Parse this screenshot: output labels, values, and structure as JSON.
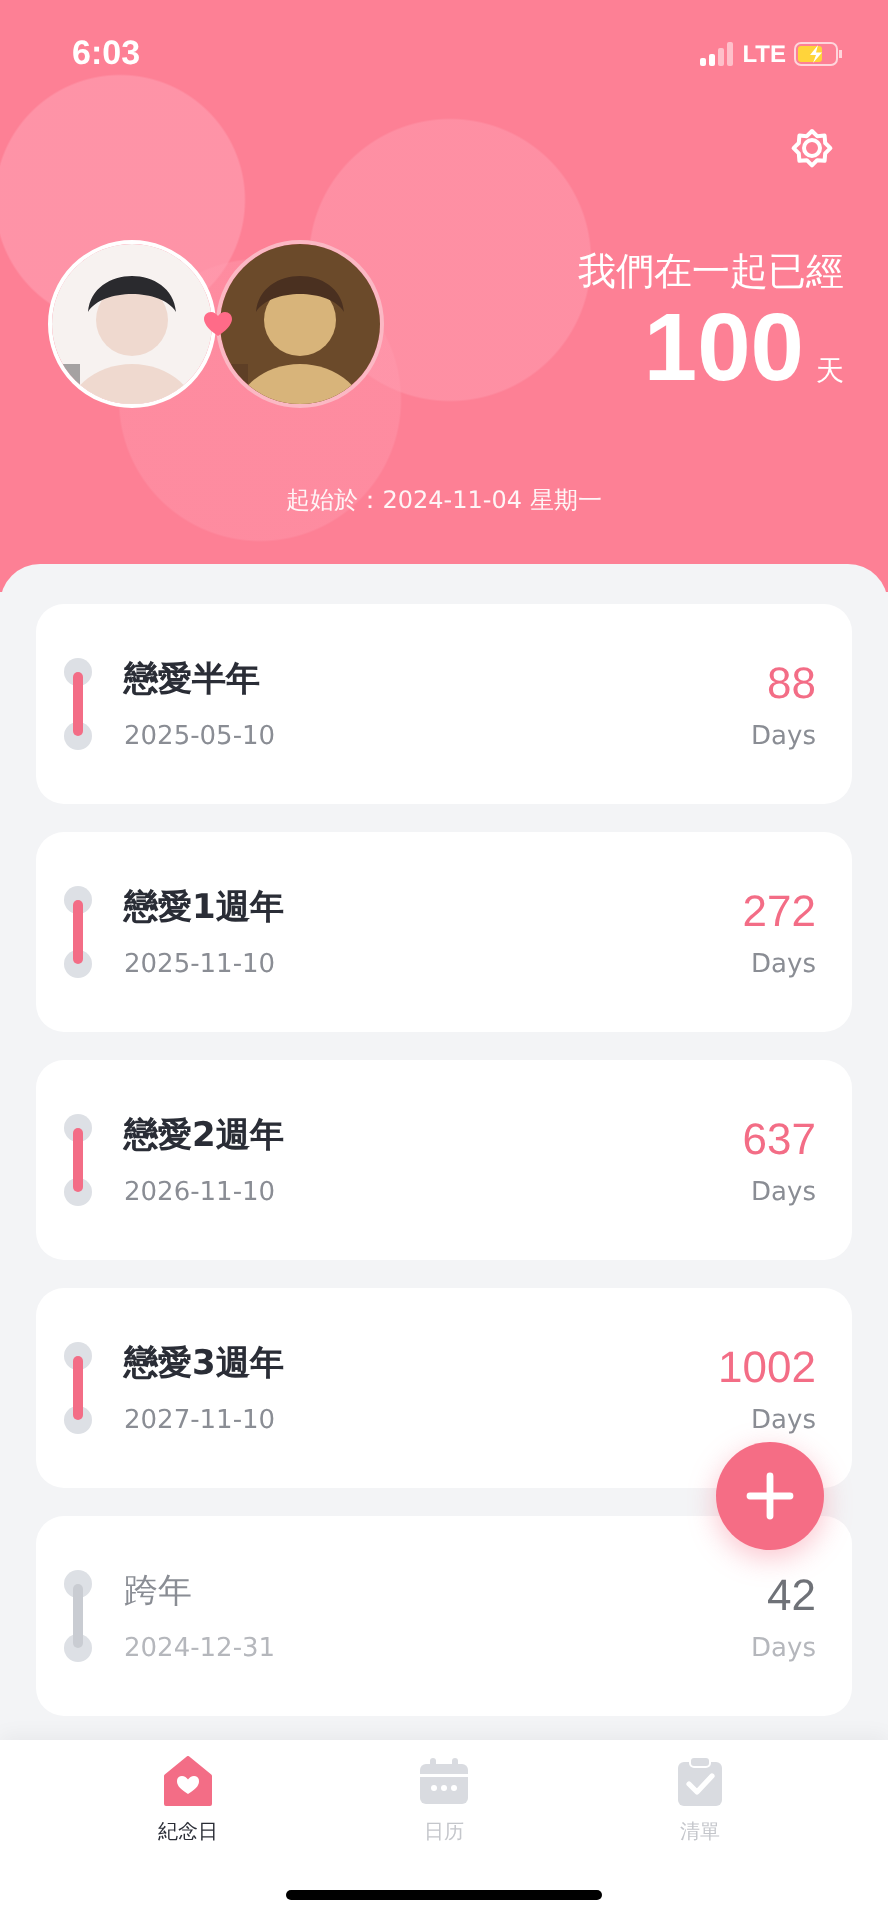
{
  "status_bar": {
    "time": "6:03",
    "network": "LTE"
  },
  "header": {
    "title": "我們在一起已經",
    "count": "100",
    "unit": "天",
    "start": "起始於：2024-11-04 星期一"
  },
  "events": [
    {
      "name": "戀愛半年",
      "date": "2025-05-10",
      "days": "88",
      "unit": "Days",
      "past": false
    },
    {
      "name": "戀愛1週年",
      "date": "2025-11-10",
      "days": "272",
      "unit": "Days",
      "past": false
    },
    {
      "name": "戀愛2週年",
      "date": "2026-11-10",
      "days": "637",
      "unit": "Days",
      "past": false
    },
    {
      "name": "戀愛3週年",
      "date": "2027-11-10",
      "days": "1002",
      "unit": "Days",
      "past": false
    },
    {
      "name": "跨年",
      "date": "2024-12-31",
      "days": "42",
      "unit": "Days",
      "past": true
    }
  ],
  "tabs": [
    {
      "label": "紀念日",
      "kind": "anniversary",
      "selected": true
    },
    {
      "label": "日历",
      "kind": "calendar",
      "selected": false
    },
    {
      "label": "清單",
      "kind": "checklist",
      "selected": false
    }
  ]
}
